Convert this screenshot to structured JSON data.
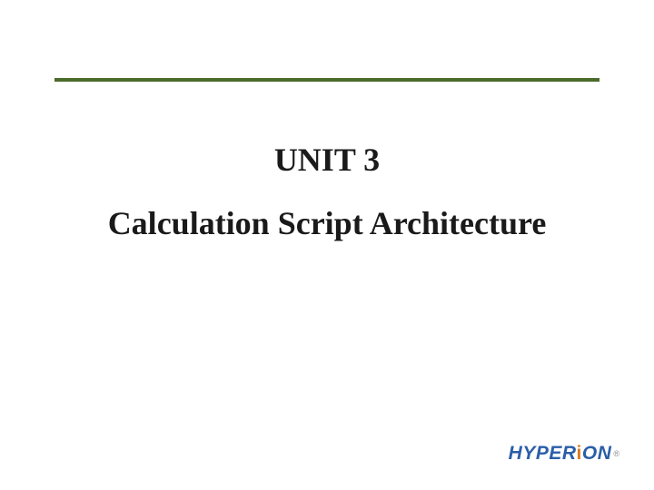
{
  "slide": {
    "unit_label": "UNIT 3",
    "title": "Calculation Script Architecture"
  },
  "branding": {
    "logo_prefix": "HYPER",
    "logo_accent": "i",
    "logo_suffix": "ON",
    "registered": "®"
  }
}
